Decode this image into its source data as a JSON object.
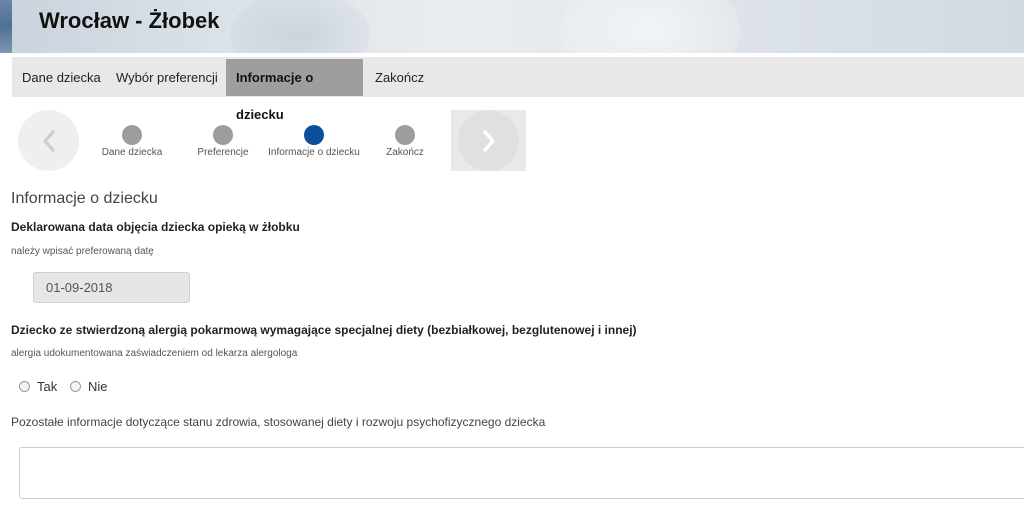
{
  "header": {
    "title": "Wrocław - Żłobek"
  },
  "tabs": [
    {
      "label": "Dane dziecka",
      "active": false
    },
    {
      "label": "Wybór preferencji",
      "active": false
    },
    {
      "label": "Informacje o dziecku",
      "active": true
    },
    {
      "label": "Zakończ",
      "active": false
    }
  ],
  "steps": [
    {
      "label": "Dane dziecka",
      "active": false
    },
    {
      "label": "Preferencje",
      "active": false
    },
    {
      "label": "Informacje o dziecku",
      "active": true
    },
    {
      "label": "Zakończ",
      "active": false
    }
  ],
  "colors": {
    "active_step": "#0c4f9c",
    "inactive_step": "#9d9d9d",
    "active_tab": "#9e9e9e"
  },
  "form": {
    "section_title": "Informacje o dziecku",
    "date_question": "Deklarowana data objęcia dziecka opieką w żłobku",
    "date_hint": "należy wpisać preferowaną datę",
    "date_value": "01-09-2018",
    "allergy_question": "Dziecko ze stwierdzoną alergią pokarmową wymagające specjalnej diety (bezbiałkowej, bezglutenowej i innej)",
    "allergy_hint": "alergia udokumentowana zaświadczeniem od lekarza alergologa",
    "option_yes": "Tak",
    "option_no": "Nie",
    "other_info_label": "Pozostałe informacje dotyczące stanu zdrowia, stosowanej diety i rozwoju psychofizycznego dziecka",
    "other_info_value": ""
  }
}
